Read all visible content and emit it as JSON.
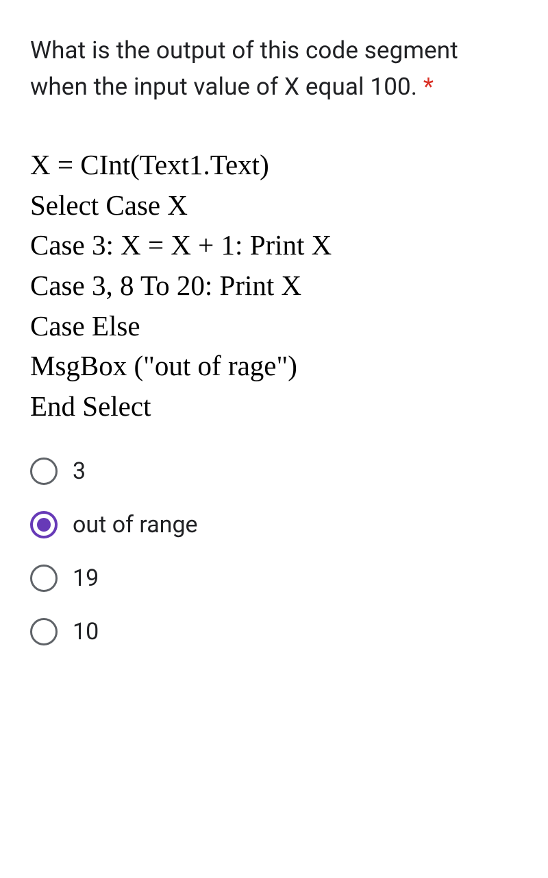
{
  "question": {
    "text": "What is the output of this code segment when the input value of X equal 100.",
    "required_marker": "*"
  },
  "code_lines": [
    "X = CInt(Text1.Text)",
    "Select Case X",
    "Case 3: X = X + 1: Print X",
    "Case 3, 8 To 20: Print X",
    "Case Else",
    "MsgBox (\"out of rage\")",
    "End Select"
  ],
  "options": [
    {
      "label": "3",
      "selected": false
    },
    {
      "label": "out of range",
      "selected": true
    },
    {
      "label": "19",
      "selected": false
    },
    {
      "label": "10",
      "selected": false
    }
  ]
}
